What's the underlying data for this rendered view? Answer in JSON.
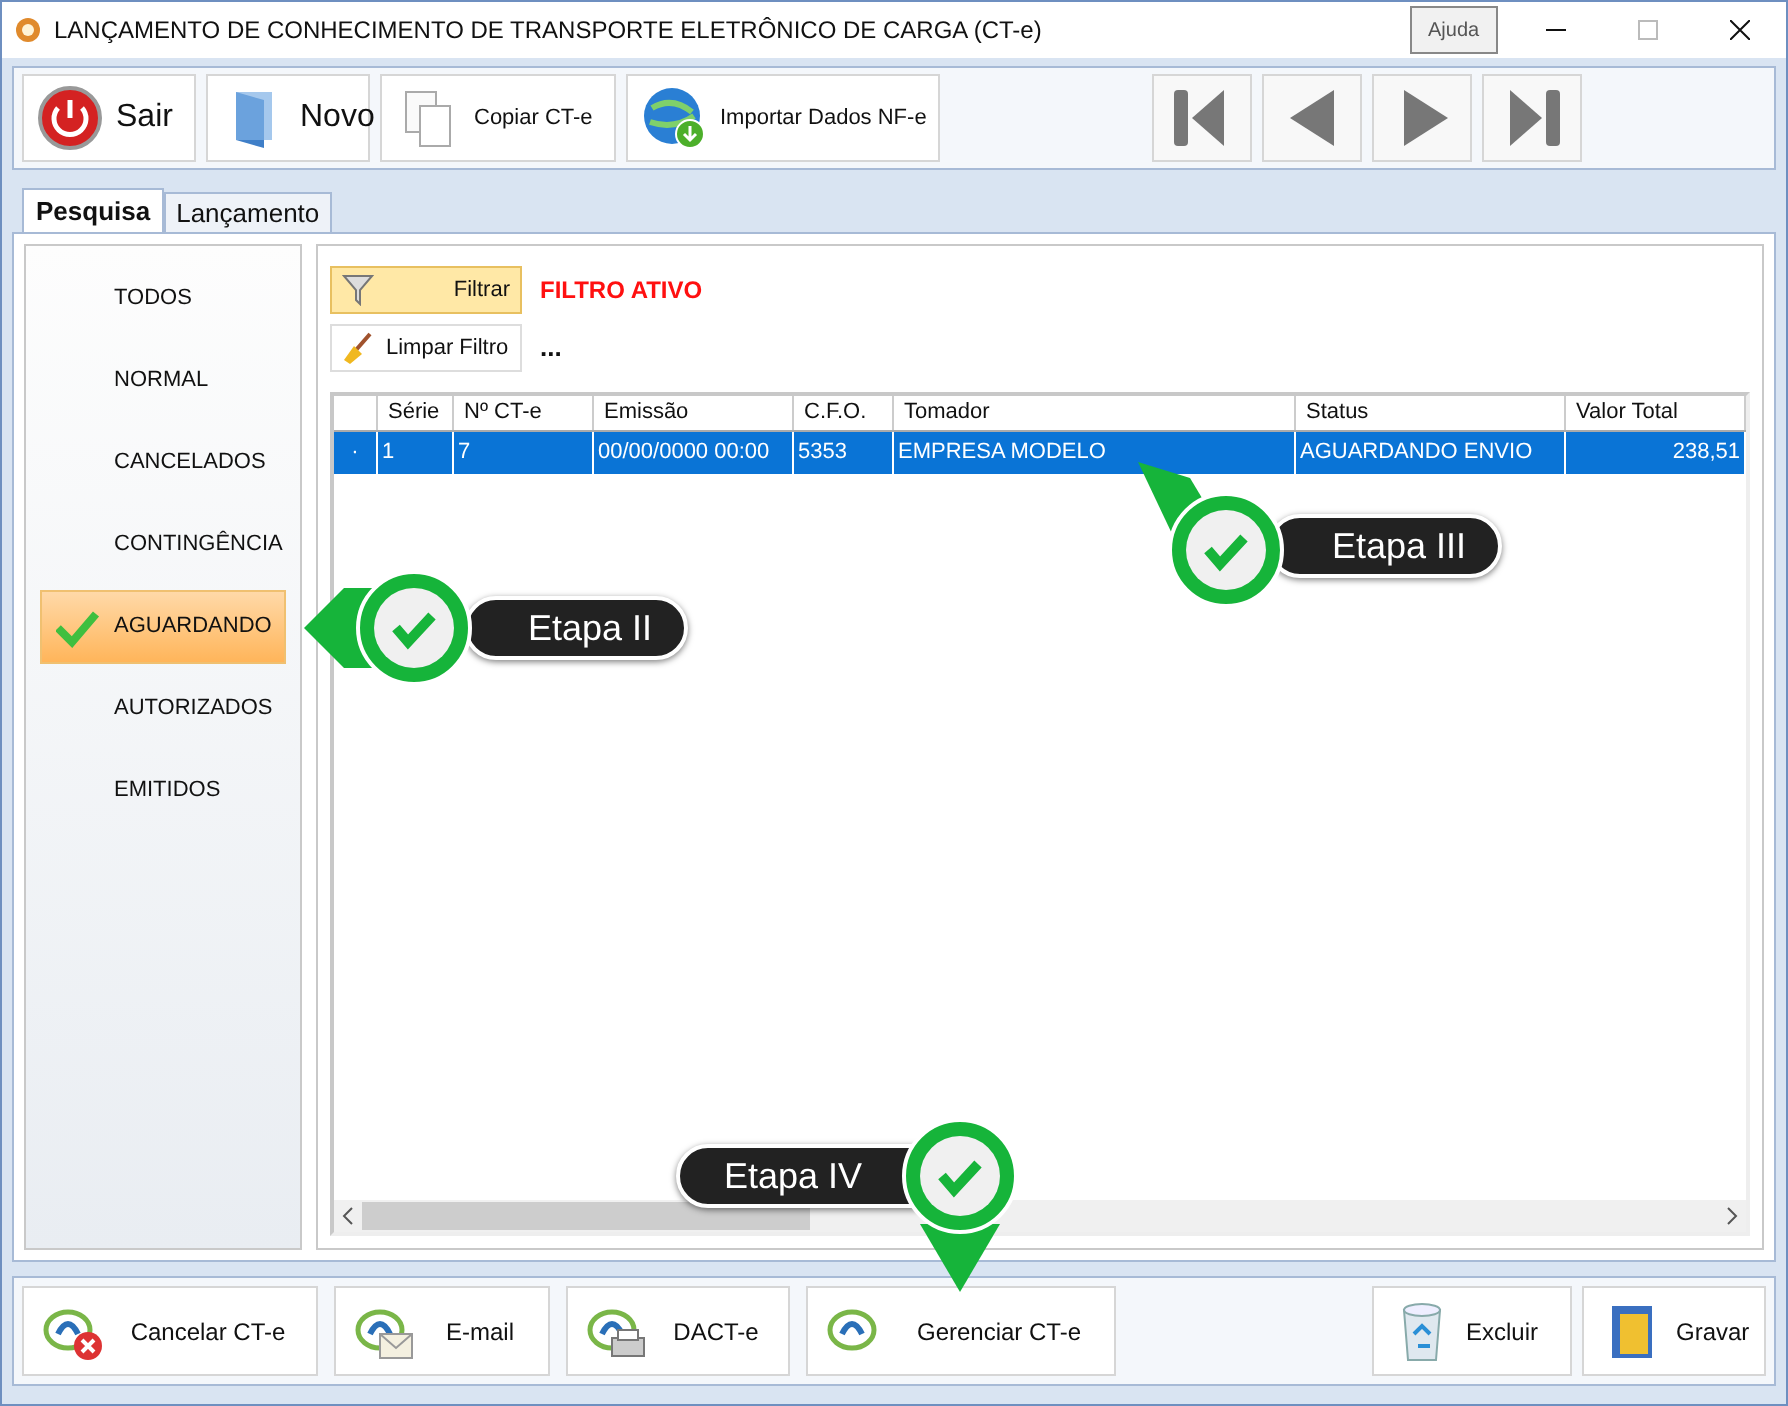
{
  "window": {
    "title": "LANÇAMENTO DE CONHECIMENTO DE TRANSPORTE ELETRÔNICO DE CARGA (CT-e)",
    "tooltip": "Ajuda"
  },
  "toolbar": [
    {
      "label": "Sair"
    },
    {
      "label": "Novo"
    },
    {
      "label": "Copiar CT-e"
    },
    {
      "label": "Importar Dados NF-e"
    }
  ],
  "tabs": [
    {
      "label": "Pesquisa",
      "selected": true
    },
    {
      "label": "Lançamento",
      "selected": false
    }
  ],
  "sidebar": {
    "items": [
      {
        "label": "TODOS",
        "selected": false
      },
      {
        "label": "NORMAL",
        "selected": false
      },
      {
        "label": "CANCELADOS",
        "selected": false
      },
      {
        "label": "CONTINGÊNCIA",
        "selected": false
      },
      {
        "label": "AGUARDANDO",
        "selected": true
      },
      {
        "label": "AUTORIZADOS",
        "selected": false
      },
      {
        "label": "EMITIDOS",
        "selected": false
      }
    ]
  },
  "filter": {
    "button": "Filtrar",
    "status": "FILTRO ATIVO",
    "clear_button": "Limpar Filtro",
    "more": "..."
  },
  "table": {
    "columns": [
      "Série",
      "Nº CT-e",
      "Emissão",
      "C.F.O.",
      "Tomador",
      "Status",
      "Valor Total"
    ],
    "rows": [
      {
        "marker": "·",
        "cells": [
          "1",
          "7",
          "00/00/0000 00:00",
          "5353",
          "EMPRESA MODELO",
          "AGUARDANDO ENVIO",
          "238,51"
        ],
        "selected": true
      }
    ]
  },
  "bottom_buttons": [
    {
      "label": "Cancelar CT-e"
    },
    {
      "label": "E-mail"
    },
    {
      "label": "DACT-e"
    },
    {
      "label": "Gerenciar CT-e"
    },
    {
      "label": "Excluir"
    },
    {
      "label": "Gravar"
    }
  ],
  "callouts": [
    {
      "label": "Etapa II"
    },
    {
      "label": "Etapa III"
    },
    {
      "label": "Etapa IV"
    }
  ]
}
